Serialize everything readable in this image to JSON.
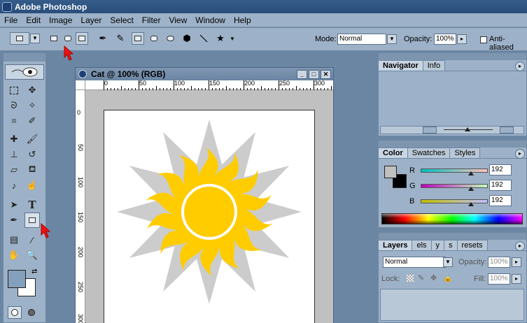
{
  "window": {
    "title": "Adobe Photoshop"
  },
  "menu": [
    "File",
    "Edit",
    "Image",
    "Layer",
    "Select",
    "Filter",
    "View",
    "Window",
    "Help"
  ],
  "options": {
    "mode_label": "Mode:",
    "mode_value": "Normal",
    "opacity_label": "Opacity:",
    "opacity_value": "100%",
    "antialiased_label": "Anti-aliased"
  },
  "document": {
    "title": "Cat @ 100% (RGB)",
    "ruler_top": [
      "0",
      "50",
      "100",
      "150",
      "200",
      "250",
      "300"
    ],
    "ruler_left": [
      "0",
      "50",
      "100",
      "150",
      "200",
      "250",
      "300"
    ]
  },
  "navigator_panel": {
    "tabs": [
      "Navigator",
      "Info"
    ]
  },
  "color_panel": {
    "tabs": [
      "Color",
      "Swatches",
      "Styles"
    ],
    "channels": [
      {
        "label": "R",
        "value": "192"
      },
      {
        "label": "G",
        "value": "192"
      },
      {
        "label": "B",
        "value": "192"
      }
    ],
    "levels": [
      0.75,
      0.75,
      0.75
    ]
  },
  "layers_panel": {
    "tabs": [
      "Layers",
      "els",
      "y",
      "s",
      "resets"
    ],
    "blend_mode": "Normal",
    "opacity_label": "Opacity:",
    "opacity_value": "100%",
    "lock_label": "Lock:",
    "fill_label": "Fill:",
    "fill_value": "100%"
  },
  "colors": {
    "sun": "#ffcc00",
    "star": "#cccccc",
    "arrow": "#ee1111"
  }
}
